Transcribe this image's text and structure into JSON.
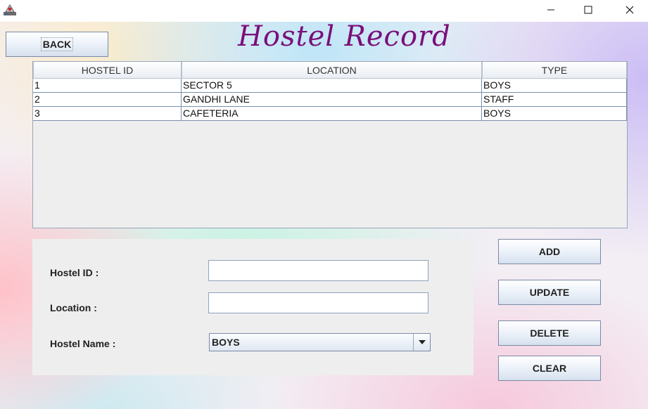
{
  "window": {
    "title": ""
  },
  "header": {
    "back_label": "BACK",
    "title": "Hostel Record"
  },
  "table": {
    "columns": [
      "HOSTEL ID",
      "LOCATION",
      "TYPE"
    ],
    "rows": [
      [
        "1",
        "SECTOR 5",
        "BOYS"
      ],
      [
        "2",
        "GANDHI LANE",
        "STAFF"
      ],
      [
        "3",
        "CAFETERIA",
        "BOYS"
      ]
    ]
  },
  "form": {
    "hostel_id_label": "Hostel ID :",
    "hostel_id_value": "",
    "location_label": "Location :",
    "location_value": "",
    "hostel_name_label": "Hostel Name :",
    "hostel_name_selected": "BOYS"
  },
  "actions": {
    "add": "ADD",
    "update": "UPDATE",
    "delete": "DELETE",
    "clear": "CLEAR"
  },
  "colors": {
    "title": "#7a0f7a",
    "panel": "#eeeeee",
    "border": "#7a8aa5"
  }
}
